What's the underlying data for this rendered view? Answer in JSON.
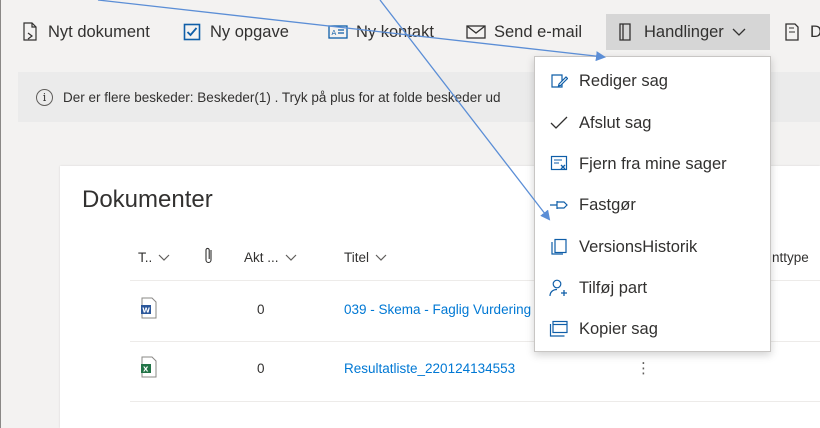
{
  "toolbar": {
    "items": [
      {
        "label": "Nyt dokument",
        "icon": "new-document-icon"
      },
      {
        "label": "Ny opgave",
        "icon": "checkbox-icon"
      },
      {
        "label": "Ny kontakt",
        "icon": "contact-card-icon"
      },
      {
        "label": "Send e-mail",
        "icon": "mail-icon"
      },
      {
        "label": "Handlinger",
        "icon": "actions-book-icon"
      },
      {
        "label": "D",
        "icon": "document-icon"
      }
    ]
  },
  "message_bar": {
    "text": "Der er flere beskeder: Beskeder(1) . Tryk på plus for at folde beskeder ud"
  },
  "documents": {
    "title": "Dokumenter",
    "columns": {
      "type": "T..",
      "attachment": "",
      "akt": "Akt ...",
      "titel": "Titel",
      "doctype": "nttype"
    },
    "rows": [
      {
        "akt": "0",
        "titel": "039 - Skema - Faglig Vurdering",
        "filetype": "word",
        "more": ""
      },
      {
        "akt": "0",
        "titel": "Resultatliste_220124134553",
        "filetype": "excel",
        "more": "⋮"
      }
    ]
  },
  "actions_menu": {
    "items": [
      {
        "label": "Rediger sag",
        "icon": "edit-icon"
      },
      {
        "label": "Afslut sag",
        "icon": "checkmark-icon"
      },
      {
        "label": "Fjern fra mine sager",
        "icon": "remove-case-icon"
      },
      {
        "label": "Fastgør",
        "icon": "pin-icon"
      },
      {
        "label": "VersionsHistorik",
        "icon": "version-history-icon"
      },
      {
        "label": "Tilføj part",
        "icon": "add-person-icon"
      },
      {
        "label": "Kopier sag",
        "icon": "copy-case-icon"
      }
    ]
  },
  "colors": {
    "accent": "#0078d4",
    "word": "#2b579a",
    "excel": "#217346",
    "arrow": "#5b8ed6"
  }
}
